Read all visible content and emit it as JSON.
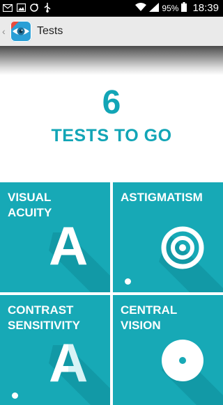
{
  "status_bar": {
    "battery": "95%",
    "time": "18:39",
    "icons": [
      "mail-icon",
      "image-icon",
      "sync-icon",
      "usb-icon",
      "wifi-icon",
      "signal-icon",
      "battery-icon"
    ]
  },
  "action_bar": {
    "title": "Tests",
    "icons": [
      "back-chevron-icon",
      "eye-app-icon"
    ]
  },
  "counter": {
    "value": "6",
    "label": "TESTS TO GO"
  },
  "tiles": [
    {
      "label": "VISUAL\nACUITY",
      "icon": "letter-a-icon",
      "glyph": "A"
    },
    {
      "label": "ASTIGMATISM",
      "icon": "target-icon"
    },
    {
      "label": "CONTRAST\nSENSITIVITY",
      "icon": "faded-letter-a-icon",
      "glyph": "A"
    },
    {
      "label": "CENTRAL\nVISION",
      "icon": "central-dot-icon"
    }
  ],
  "colors": {
    "accent": "#12a5b6",
    "tile": "#17a9b6",
    "tile_shadow": "#0f8f9b",
    "statusbar": "#000000",
    "actionbar": "#eaeaea"
  }
}
